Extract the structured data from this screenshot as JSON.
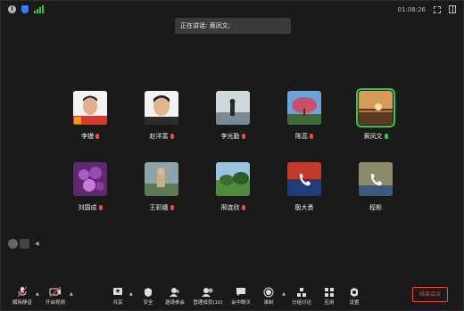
{
  "status": {
    "time": "01:08:26"
  },
  "speaking": {
    "label": "正在讲话: 黄凤文;"
  },
  "participants": [
    {
      "name": "李嫚",
      "avatar": "portrait-photo",
      "mic": "muted",
      "host": true
    },
    {
      "name": "赵洋富",
      "avatar": "portrait-photo",
      "mic": "muted"
    },
    {
      "name": "李光勤",
      "avatar": "lake-photo",
      "mic": "muted"
    },
    {
      "name": "陈蕊",
      "avatar": "tree-photo",
      "mic": "muted"
    },
    {
      "name": "黄凤文",
      "avatar": "sunset-photo",
      "mic": "active",
      "active": true
    },
    {
      "name": "刘国成",
      "avatar": "flower-photo",
      "mic": "muted"
    },
    {
      "name": "王彩娥",
      "avatar": "outdoor-photo",
      "mic": "muted"
    },
    {
      "name": "邢连欣",
      "avatar": "park-photo",
      "mic": "muted"
    },
    {
      "name": "殷大勇",
      "avatar": "phone-icon",
      "mic": "none"
    },
    {
      "name": "程彬",
      "avatar": "phone-icon",
      "mic": "none"
    }
  ],
  "toolbar": {
    "unmute": "解除静音",
    "start_video": "开启视频",
    "share": "共享",
    "security": "安全",
    "invite": "邀请参会",
    "manage": "管理成员(10)",
    "chat": "会中聊天",
    "record": "录制",
    "breakout": "分组讨论",
    "apps": "应用",
    "settings": "设置",
    "end": "结束会议"
  },
  "colors": {
    "accent_green": "#2ecc40",
    "danger_red": "#e74c3c"
  }
}
